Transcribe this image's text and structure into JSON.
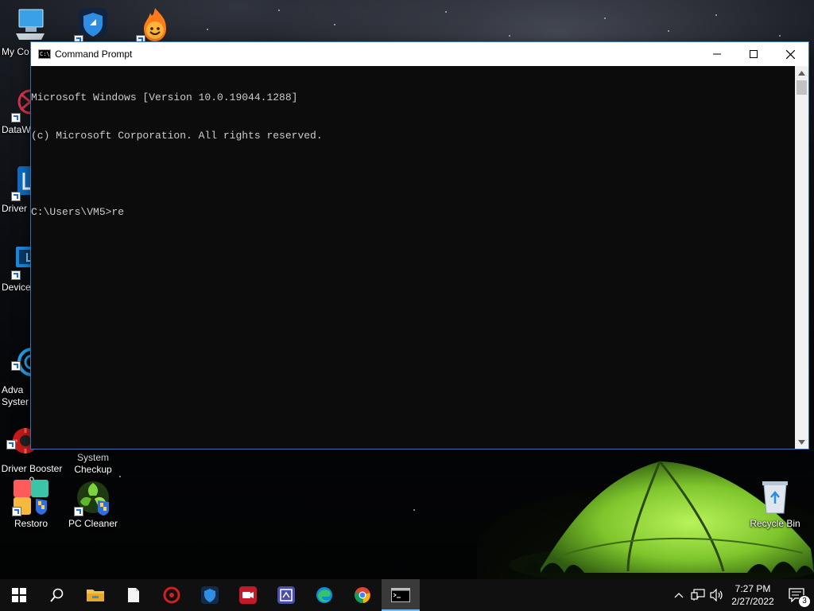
{
  "window": {
    "title": "Command Prompt",
    "console_lines": [
      "Microsoft Windows [Version 10.0.19044.1288]",
      "(c) Microsoft Corporation. All rights reserved.",
      "",
      "C:\\Users\\VM5>re"
    ]
  },
  "desktop": {
    "icons": [
      {
        "label": "My Co",
        "icon": "my-computer-icon"
      },
      {
        "label": "DataW",
        "icon": "datawing-icon"
      },
      {
        "label": "Driver",
        "icon": "driver-updater-icon"
      },
      {
        "label": "Device",
        "icon": "device-manager-icon"
      },
      {
        "label": "Adva\nSyster",
        "icon": "advanced-system-icon"
      },
      {
        "label": "Driver Booster\n9",
        "icon": "driver-booster-icon"
      },
      {
        "label": "System\nCheckup",
        "icon": "system-checkup-icon"
      },
      {
        "label": "Restoro",
        "icon": "restoro-icon"
      },
      {
        "label": "PC Cleaner",
        "icon": "pc-cleaner-icon"
      },
      {
        "label": "Recycle Bin",
        "icon": "recycle-bin-icon"
      }
    ]
  },
  "taskbar": {
    "time": "7:27 PM",
    "date": "2/27/2022",
    "notification_count": "3",
    "items": [
      "start",
      "search",
      "file-explorer",
      "file",
      "driver-booster",
      "vpn-shield",
      "screen-recorder",
      "system-app",
      "edge",
      "chrome",
      "command-prompt"
    ]
  },
  "colors": {
    "console_bg": "#0c0c0c",
    "console_text": "#cccccc",
    "taskbar_bg": "#101010",
    "tent_green": "#8fd63a"
  }
}
